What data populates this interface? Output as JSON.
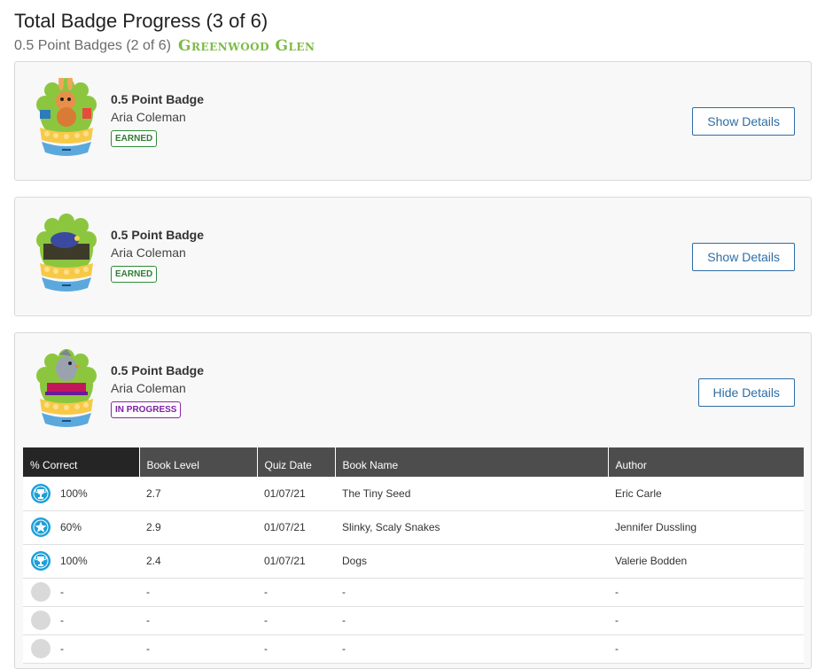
{
  "header": {
    "title": "Total Badge Progress (3 of 6)",
    "subtitle": "0.5 Point Badges (2 of 6)",
    "collection": "Greenwood Glen"
  },
  "cards": [
    {
      "badge_icon": "rabbit-badge-icon",
      "title": "0.5 Point Badge",
      "student": "Aria Coleman",
      "status": "EARNED",
      "button": "Show Details"
    },
    {
      "badge_icon": "bug-badge-icon",
      "title": "0.5 Point Badge",
      "student": "Aria Coleman",
      "status": "EARNED",
      "button": "Show Details"
    },
    {
      "badge_icon": "bird-badge-icon",
      "title": "0.5 Point Badge",
      "student": "Aria Coleman",
      "status": "IN PROGRESS",
      "button": "Hide Details"
    }
  ],
  "table": {
    "headers": [
      "% Correct",
      "Book Level",
      "Quiz Date",
      "Book Name",
      "Author"
    ],
    "rows": [
      {
        "icon": "trophy-icon",
        "correct": "100%",
        "level": "2.7",
        "date": "01/07/21",
        "book": "The Tiny Seed",
        "author": "Eric Carle"
      },
      {
        "icon": "star-icon",
        "correct": "60%",
        "level": "2.9",
        "date": "01/07/21",
        "book": "Slinky, Scaly Snakes",
        "author": "Jennifer Dussling"
      },
      {
        "icon": "trophy-icon",
        "correct": "100%",
        "level": "2.4",
        "date": "01/07/21",
        "book": "Dogs",
        "author": "Valerie Bodden"
      },
      {
        "icon": "empty-circle-icon",
        "correct": "-",
        "level": "-",
        "date": "-",
        "book": "-",
        "author": "-"
      },
      {
        "icon": "empty-circle-icon",
        "correct": "-",
        "level": "-",
        "date": "-",
        "book": "-",
        "author": "-"
      },
      {
        "icon": "empty-circle-icon",
        "correct": "-",
        "level": "-",
        "date": "-",
        "book": "-",
        "author": "-"
      }
    ]
  },
  "colors": {
    "earned": "#2e7d32",
    "in_progress": "#7b1fa2",
    "button_blue": "#2e6da4",
    "icon_blue": "#1e9fd9",
    "collection_green": "#7dbb45"
  }
}
